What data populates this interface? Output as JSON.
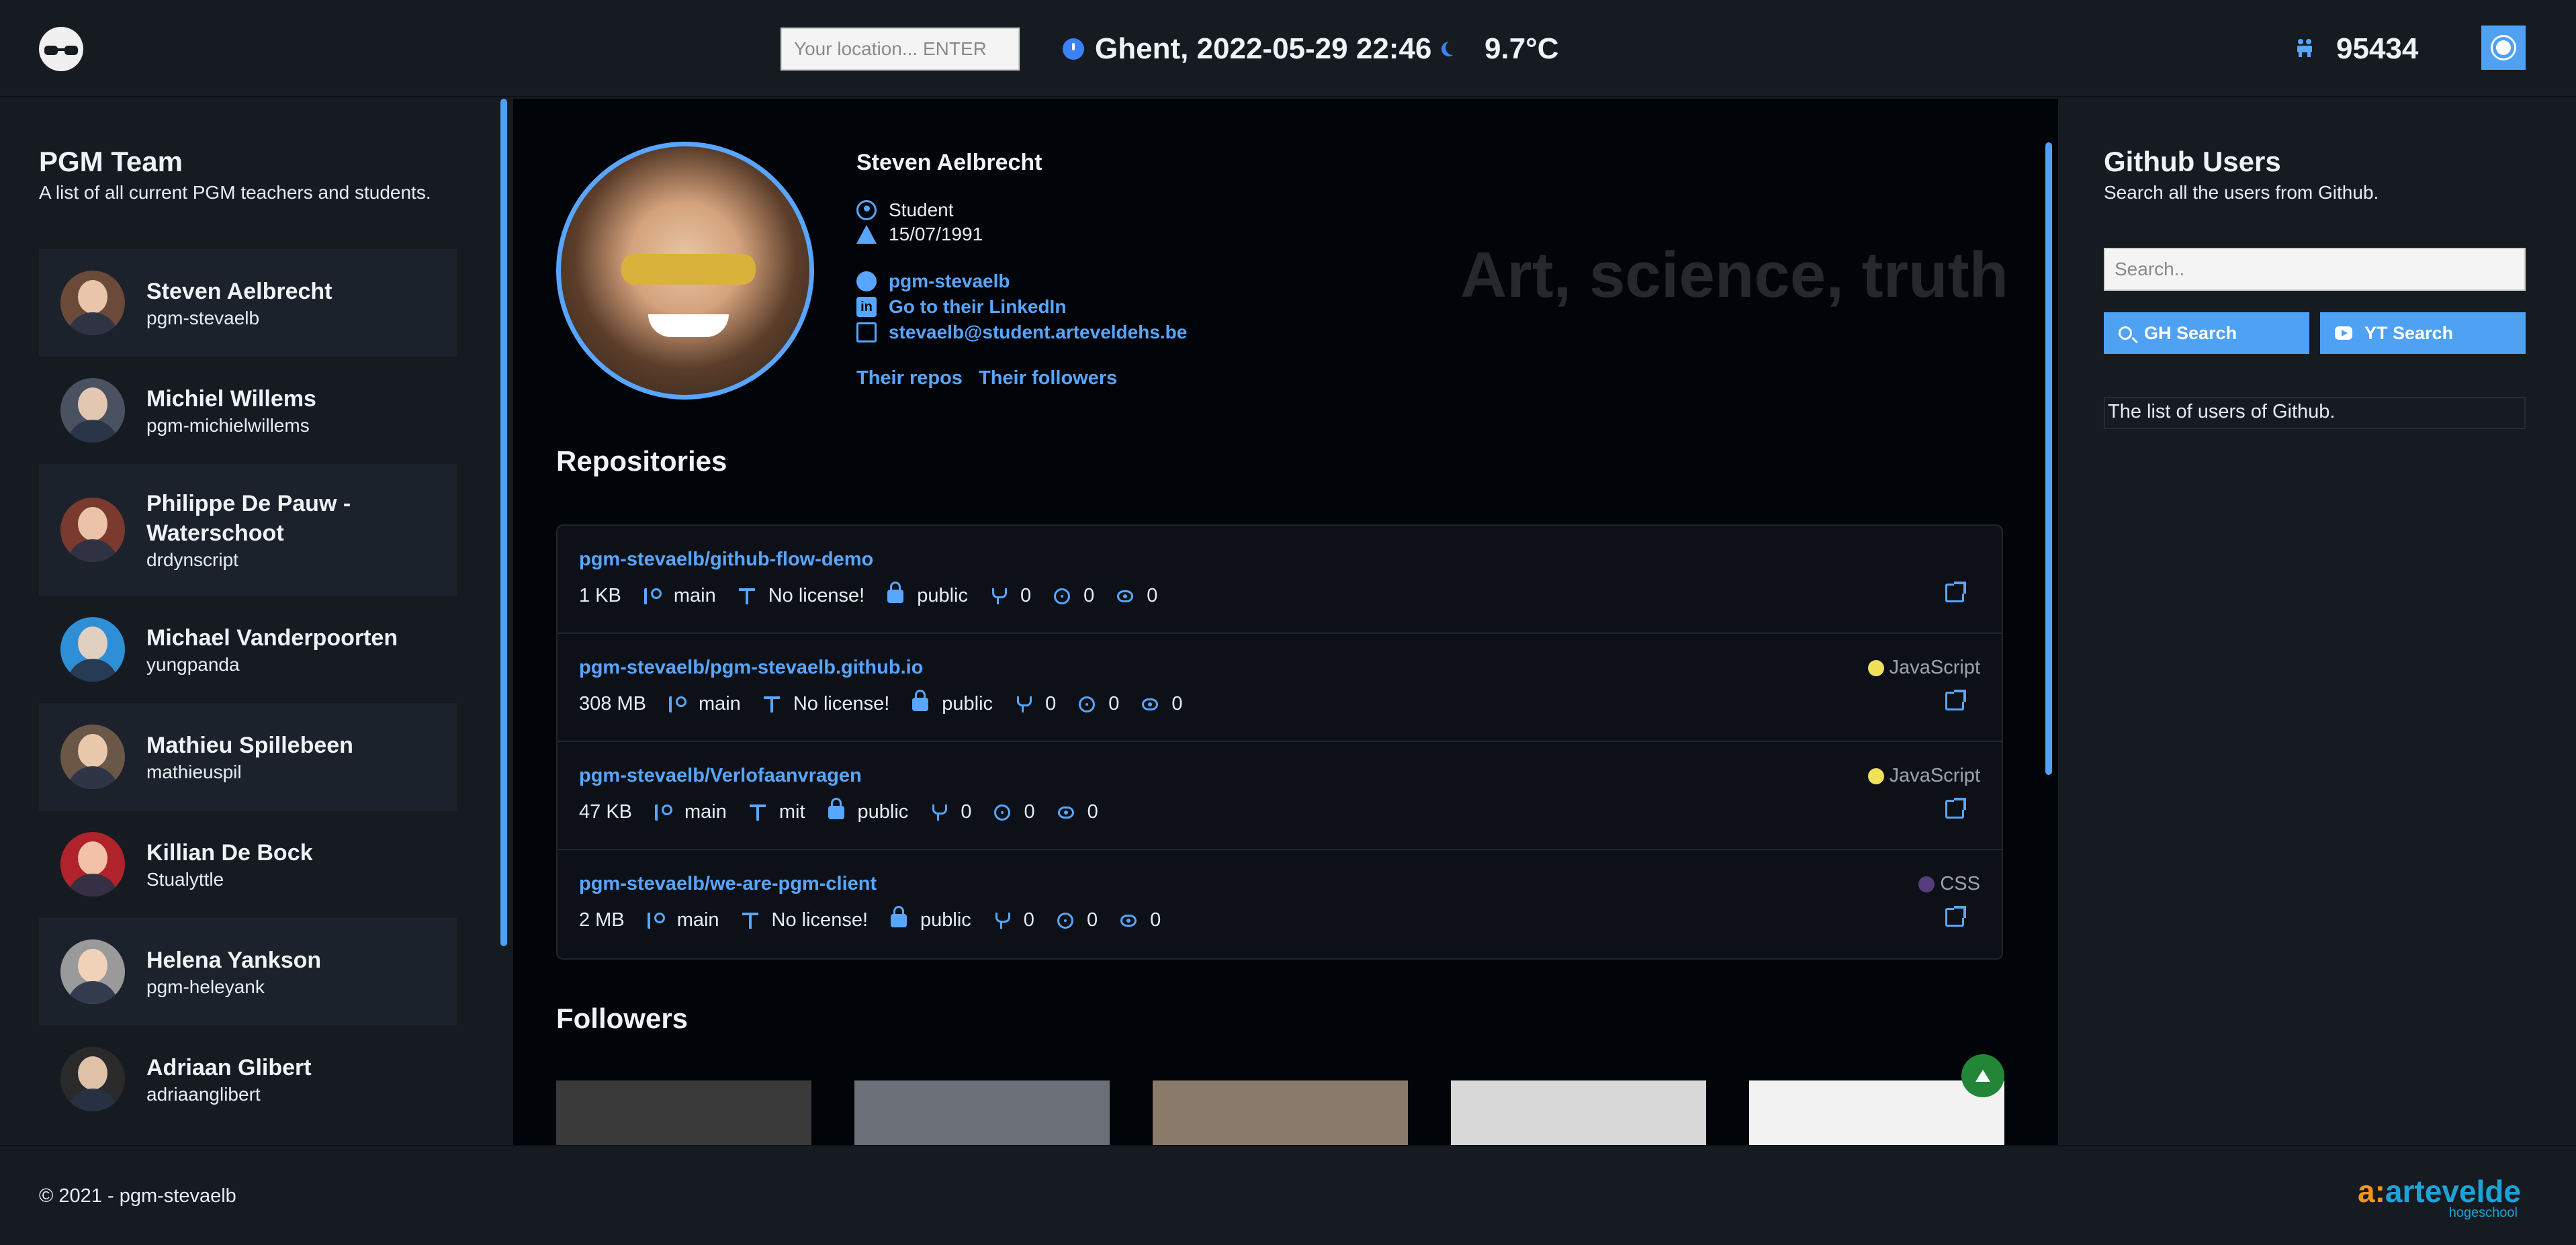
{
  "header": {
    "location_placeholder": "Your location... ENTER",
    "location_datetime": "Ghent, 2022-05-29 22:46",
    "temperature": "9.7°C",
    "worker_count": "95434"
  },
  "left": {
    "title": "PGM Team",
    "subtitle": "A list of all current PGM teachers and students.",
    "members": [
      {
        "name": "Steven Aelbrecht",
        "handle": "pgm-stevaelb",
        "color": "#6b4a3a"
      },
      {
        "name": "Michiel Willems",
        "handle": "pgm-michielwillems",
        "color": "#4a5160"
      },
      {
        "name": "Philippe De Pauw - Waterschoot",
        "handle": "drdynscript",
        "color": "#7a3a2e"
      },
      {
        "name": "Michael Vanderpoorten",
        "handle": "yungpanda",
        "color": "#2f8fd6"
      },
      {
        "name": "Mathieu Spillebeen",
        "handle": "mathieuspil",
        "color": "#6b5748"
      },
      {
        "name": "Killian De Bock",
        "handle": "Stualyttle",
        "color": "#b0232a"
      },
      {
        "name": "Helena Yankson",
        "handle": "pgm-heleyank",
        "color": "#9a9a9a"
      },
      {
        "name": "Adriaan Glibert",
        "handle": "adriaanglibert",
        "color": "#2a2a2a"
      }
    ]
  },
  "profile": {
    "name": "Steven Aelbrecht",
    "role": "Student",
    "birthday": "15/07/1991",
    "github": "pgm-stevaelb",
    "linkedin": "Go to their LinkedIn",
    "email": "stevaelb@student.arteveldehs.be",
    "repos_link": "Their repos",
    "followers_link": "Their followers",
    "motto": "Art, science, truth"
  },
  "repositories": {
    "title": "Repositories",
    "items": [
      {
        "name": "pgm-stevaelb/github-flow-demo",
        "size": "1 KB",
        "branch": "main",
        "license": "No license!",
        "visibility": "public",
        "forks": "0",
        "issues": "0",
        "watchers": "0",
        "language": "",
        "lang_color": ""
      },
      {
        "name": "pgm-stevaelb/pgm-stevaelb.github.io",
        "size": "308 MB",
        "branch": "main",
        "license": "No license!",
        "visibility": "public",
        "forks": "0",
        "issues": "0",
        "watchers": "0",
        "language": "JavaScript",
        "lang_color": "#f1e05a"
      },
      {
        "name": "pgm-stevaelb/Verlofaanvragen",
        "size": "47 KB",
        "branch": "main",
        "license": "mit",
        "visibility": "public",
        "forks": "0",
        "issues": "0",
        "watchers": "0",
        "language": "JavaScript",
        "lang_color": "#f1e05a"
      },
      {
        "name": "pgm-stevaelb/we-are-pgm-client",
        "size": "2 MB",
        "branch": "main",
        "license": "No license!",
        "visibility": "public",
        "forks": "0",
        "issues": "0",
        "watchers": "0",
        "language": "CSS",
        "lang_color": "#563d7c"
      }
    ]
  },
  "followers": {
    "title": "Followers",
    "tones": [
      "#3a3a3a",
      "#6a6f78",
      "#8a7a6a",
      "#d8d8d8",
      "#f2f2f2"
    ]
  },
  "right": {
    "title": "Github Users",
    "subtitle": "Search all the users from Github.",
    "search_placeholder": "Search..",
    "gh_button": "GH Search",
    "yt_button": "YT Search",
    "list_text": "The list of users of Github."
  },
  "footer": {
    "copyright": "© 2021 - pgm-stevaelb",
    "brand_prefix": "a:",
    "brand_name": "artevelde",
    "brand_sub": "hogeschool"
  },
  "colors": {
    "accent": "#58a6ff",
    "button": "#4ea1f3",
    "background": "#161b22",
    "main_background": "#010409"
  }
}
